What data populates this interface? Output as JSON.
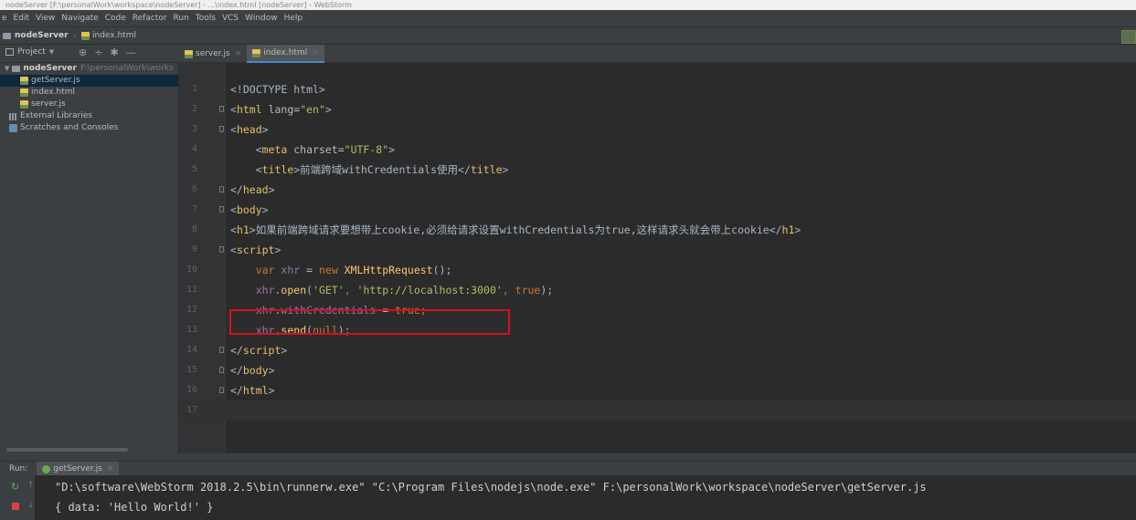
{
  "window": {
    "title": "nodeServer [F:\\personalWork\\workspace\\nodeServer] - ...\\index.html [nodeServer] - WebStorm"
  },
  "menu": [
    "e",
    "Edit",
    "View",
    "Navigate",
    "Code",
    "Refactor",
    "Run",
    "Tools",
    "VCS",
    "Window",
    "Help"
  ],
  "breadcrumb": {
    "project": "nodeServer",
    "file": "index.html"
  },
  "project_panel": {
    "label": "Project"
  },
  "tabs": [
    {
      "label": "server.js",
      "active": false
    },
    {
      "label": "index.html",
      "active": true
    }
  ],
  "tree": {
    "root": {
      "name": "nodeServer",
      "path": "F:\\personalWork\\works"
    },
    "files": [
      "getServer.js",
      "index.html",
      "server.js"
    ],
    "external": "External Libraries",
    "scratches": "Scratches and Consoles"
  },
  "editor": {
    "lines": [
      {
        "n": "1",
        "t": [
          [
            "txt",
            "<!DOCTYPE html>"
          ]
        ]
      },
      {
        "n": "2",
        "t": [
          [
            "txt",
            "<"
          ],
          [
            "tg",
            "html "
          ],
          [
            "at",
            "lang="
          ],
          [
            "sv",
            "\"en\""
          ],
          [
            "txt",
            ">"
          ]
        ]
      },
      {
        "n": "3",
        "t": [
          [
            "txt",
            "<"
          ],
          [
            "tg",
            "head"
          ],
          [
            "txt",
            ">"
          ]
        ]
      },
      {
        "n": "4",
        "t": [
          [
            "txt",
            "    <"
          ],
          [
            "tg",
            "meta "
          ],
          [
            "at",
            "charset="
          ],
          [
            "sv",
            "\"UTF-8\""
          ],
          [
            "txt",
            ">"
          ]
        ]
      },
      {
        "n": "5",
        "t": [
          [
            "txt",
            "    <"
          ],
          [
            "tg",
            "title"
          ],
          [
            "txt",
            ">前端跨域withCredentials使用</"
          ],
          [
            "tg",
            "title"
          ],
          [
            "txt",
            ">"
          ]
        ]
      },
      {
        "n": "6",
        "t": [
          [
            "txt",
            "</"
          ],
          [
            "tg",
            "head"
          ],
          [
            "txt",
            ">"
          ]
        ]
      },
      {
        "n": "7",
        "t": [
          [
            "txt",
            "<"
          ],
          [
            "tg",
            "body"
          ],
          [
            "txt",
            ">"
          ]
        ]
      },
      {
        "n": "8",
        "t": [
          [
            "txt",
            "<"
          ],
          [
            "tg",
            "h1"
          ],
          [
            "txt",
            ">如果前端跨域请求要想带上cookie,必须给请求设置withCredentials为true,这样请求头就会带上cookie</"
          ],
          [
            "tg",
            "h1"
          ],
          [
            "txt",
            ">"
          ]
        ]
      },
      {
        "n": "9",
        "t": [
          [
            "txt",
            "<"
          ],
          [
            "tg",
            "script"
          ],
          [
            "txt",
            ">"
          ]
        ]
      },
      {
        "n": "10",
        "t": [
          [
            "txt",
            "    "
          ],
          [
            "kw",
            "var "
          ],
          [
            "pl",
            "xhr"
          ],
          [
            "txt",
            " = "
          ],
          [
            "kw",
            "new "
          ],
          [
            "fn",
            "XMLHttpRequest"
          ],
          [
            "txt",
            "();"
          ]
        ]
      },
      {
        "n": "11",
        "t": [
          [
            "txt",
            "    "
          ],
          [
            "pl",
            "xhr"
          ],
          [
            "txt",
            "."
          ],
          [
            "fn",
            "open"
          ],
          [
            "txt",
            "("
          ],
          [
            "sv",
            "'GET'"
          ],
          [
            "kw",
            ", "
          ],
          [
            "sv",
            "'http://localhost:3000'"
          ],
          [
            "kw",
            ", "
          ],
          [
            "kw",
            "true"
          ],
          [
            "txt",
            ");"
          ]
        ]
      },
      {
        "n": "12",
        "t": [
          [
            "txt",
            "    "
          ],
          [
            "pl",
            "xhr"
          ],
          [
            "txt",
            "."
          ],
          [
            "pl",
            "withCredentials"
          ],
          [
            "txt",
            " = "
          ],
          [
            "kw",
            "true"
          ],
          [
            "kw",
            ";"
          ]
        ]
      },
      {
        "n": "13",
        "t": [
          [
            "txt",
            "    "
          ],
          [
            "pl",
            "xhr"
          ],
          [
            "txt",
            "."
          ],
          [
            "fn",
            "send"
          ],
          [
            "txt",
            "("
          ],
          [
            "kw",
            "null"
          ],
          [
            "txt",
            ");"
          ]
        ]
      },
      {
        "n": "14",
        "t": [
          [
            "txt",
            "</"
          ],
          [
            "tg",
            "script"
          ],
          [
            "txt",
            ">"
          ]
        ]
      },
      {
        "n": "15",
        "t": [
          [
            "txt",
            "</"
          ],
          [
            "tg",
            "body"
          ],
          [
            "txt",
            ">"
          ]
        ]
      },
      {
        "n": "16",
        "t": [
          [
            "txt",
            "</"
          ],
          [
            "tg",
            "html"
          ],
          [
            "txt",
            ">"
          ]
        ]
      },
      {
        "n": "17",
        "t": []
      }
    ]
  },
  "run": {
    "label": "Run:",
    "tab": "getServer.js",
    "output": [
      "\"D:\\software\\WebStorm 2018.2.5\\bin\\runnerw.exe\" \"C:\\Program Files\\nodejs\\node.exe\" F:\\personalWork\\workspace\\nodeServer\\getServer.js",
      "{ data: 'Hello World!' }"
    ]
  },
  "colors": {
    "highlight_box": "#d7101c",
    "accent": "#4a88c7"
  },
  "icons": [
    "project-icon",
    "target-icon",
    "collapse-icon",
    "gear-icon",
    "hide-icon",
    "js-file-icon",
    "html-file-icon",
    "folder-icon",
    "library-icon",
    "scratch-icon",
    "node-icon",
    "rerun-icon",
    "stop-icon"
  ]
}
